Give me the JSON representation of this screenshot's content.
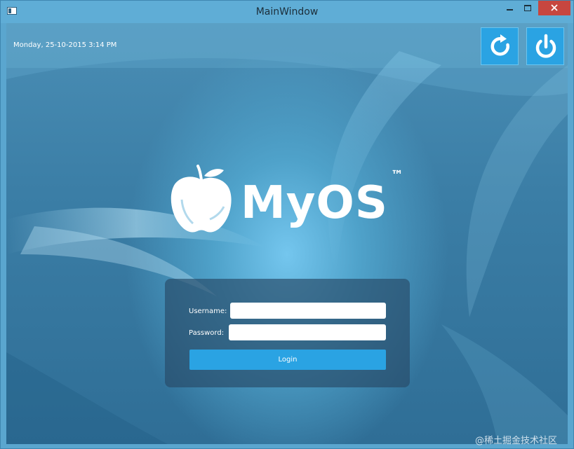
{
  "window": {
    "title": "MainWindow"
  },
  "topbar": {
    "datetime": "Monday, 25-10-2015 3:14 PM",
    "restart_icon": "restart-icon",
    "shutdown_icon": "power-icon"
  },
  "brand": {
    "logo_icon": "apple-icon",
    "name": "MyOS",
    "trademark": "™"
  },
  "login": {
    "username_label": "Username:",
    "password_label": "Password:",
    "username_value": "",
    "password_value": "",
    "button_label": "Login"
  },
  "watermark": "@稀土掘金技术社区",
  "colors": {
    "accent": "#2aa3e3",
    "titlebar": "#5fadd6",
    "close": "#c7463f"
  }
}
